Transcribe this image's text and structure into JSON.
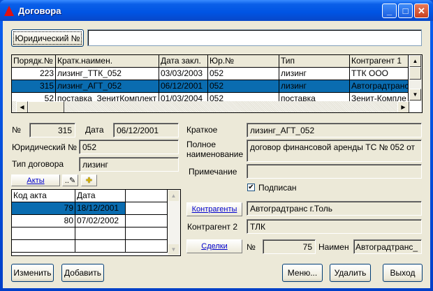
{
  "window": {
    "title": "Договора"
  },
  "search": {
    "button": "Юридический №",
    "value": ""
  },
  "contracts": {
    "columns": [
      "Порядк.№",
      "Кратк.наимен.",
      "Дата закл.",
      "Юр.№",
      "Тип",
      "Контрагент 1"
    ],
    "rows": [
      [
        "223",
        "лизинг_ТТК_052",
        "03/03/2003",
        "052",
        "лизинг",
        "ТТК ООО"
      ],
      [
        "315",
        "лизинг_АГТ_052",
        "06/12/2001",
        "052",
        "лизинг",
        "Автоградтранс"
      ],
      [
        "52",
        "поставка_ЗенитКомплект",
        "01/03/2004",
        "052",
        "поставка",
        "Зенит-Компле"
      ]
    ],
    "selected_row": 1
  },
  "details": {
    "num_label": "№",
    "num": "315",
    "date_label": "Дата",
    "date": "06/12/2001",
    "legal_label": "Юридический №",
    "legal": "052",
    "type_label": "Тип договора",
    "type": "лизинг",
    "short_label": "Краткое",
    "short": "лизинг_АГТ_052",
    "full_label_1": "Полное",
    "full_label_2": "наименование",
    "full": "договор финансовой аренды ТС № 052 от",
    "note_label": "Примечание",
    "note": "",
    "signed_label": "Подписан",
    "signed": true,
    "contractors_button": "Контрагенты",
    "contractor1": "Автоградтранс г.Толь",
    "contractor2_label": "Контрагент 2",
    "contractor2": "ТЛК",
    "deals_button": "Сделки",
    "deal_num_label": "№",
    "deal_num": "75",
    "deal_name_label": "Наимен",
    "deal_name": "Автоградтранс_"
  },
  "acts": {
    "button": "Акты",
    "edit_glyph": "..✎",
    "add_glyph": "✚",
    "columns": [
      "Код акта",
      "Дата",
      ""
    ],
    "rows": [
      [
        "79",
        "18/12/2001",
        ""
      ],
      [
        "80",
        "07/02/2002",
        ""
      ],
      [
        "",
        "",
        ""
      ],
      [
        "",
        "",
        ""
      ]
    ],
    "selected_row": 0
  },
  "buttons": {
    "edit": "Изменить",
    "add": "Добавить",
    "menu": "Меню...",
    "delete": "Удалить",
    "exit": "Выход"
  }
}
